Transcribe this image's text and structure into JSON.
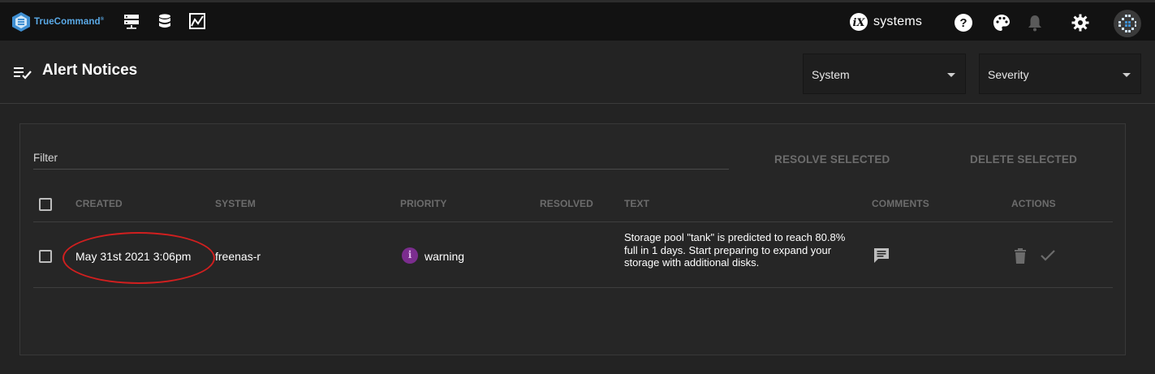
{
  "app": {
    "logo_text": "TrueCommand",
    "vendor_brand": "systems"
  },
  "page": {
    "title": "Alert Notices",
    "filters": {
      "system_label": "System",
      "severity_label": "Severity"
    }
  },
  "toolbar": {
    "filter_placeholder": "Filter",
    "resolve_selected_label": "RESOLVE SELECTED",
    "delete_selected_label": "DELETE SELECTED"
  },
  "table": {
    "columns": {
      "created": "CREATED",
      "system": "SYSTEM",
      "priority": "PRIORITY",
      "resolved": "RESOLVED",
      "text": "TEXT",
      "comments": "COMMENTS",
      "actions": "ACTIONS"
    },
    "rows": [
      {
        "created": "May 31st 2021 3:06pm",
        "system": "freenas-r",
        "priority": "warning",
        "priority_icon": "i",
        "resolved": "",
        "text": "Storage pool \"tank\" is predicted to reach 80.8% full in 1 days. Start preparing to expand your storage with additional disks."
      }
    ]
  },
  "colors": {
    "topbar_bg": "#121212",
    "page_bg": "#232323",
    "card_bg": "#262626",
    "accent_logo": "#5aa9e6",
    "priority_warning": "#7b2d8e",
    "highlight_annotation": "#d11f1f",
    "muted_text": "#6c6c6c"
  }
}
